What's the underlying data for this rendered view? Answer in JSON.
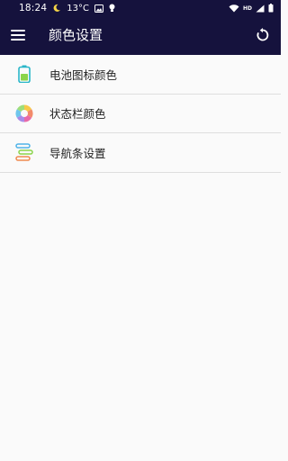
{
  "status_bar": {
    "time": "18:24",
    "temperature": "13°C",
    "left_icons": [
      "moon-icon",
      "image-icon",
      "lightbulb-icon"
    ],
    "right_icons": [
      "wifi-icon",
      "hd-icon",
      "signal-icon",
      "battery-icon"
    ],
    "hd_label": "HD",
    "background_color": "#15123d"
  },
  "app_bar": {
    "title": "颜色设置",
    "menu_icon": "menu-icon",
    "action_icon": "reset-icon",
    "background_color": "#15123d"
  },
  "settings": {
    "items": [
      {
        "label": "电池图标颜色",
        "icon": "battery-color-icon"
      },
      {
        "label": "状态栏颜色",
        "icon": "color-wheel-icon"
      },
      {
        "label": "导航条设置",
        "icon": "navigation-bar-icon"
      }
    ]
  }
}
